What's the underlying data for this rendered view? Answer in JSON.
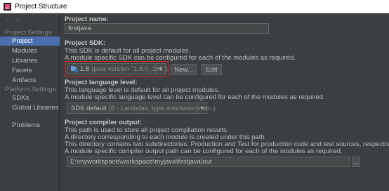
{
  "window": {
    "title": "Project Structure"
  },
  "sidebar": {
    "sections": [
      {
        "label": "Project Settings"
      },
      {
        "label": "Platform Settings"
      }
    ],
    "items": [
      {
        "label": "Project"
      },
      {
        "label": "Modules"
      },
      {
        "label": "Libraries"
      },
      {
        "label": "Facets"
      },
      {
        "label": "Artifacts"
      },
      {
        "label": "SDKs"
      },
      {
        "label": "Global Libraries"
      },
      {
        "label": "Problems"
      }
    ],
    "selected": "Project"
  },
  "project_name": {
    "label": "Project name:",
    "value": "firstjava"
  },
  "project_sdk": {
    "label": "Project SDK:",
    "desc1": "This SDK is default for all project modules.",
    "desc2": "A module specific SDK can be configured for each of the modules as required.",
    "value_main": "1.8",
    "value_detail": "(java version \"1.8.0_161\")",
    "new_label": "New...",
    "edit_label": "Edit"
  },
  "language_level": {
    "label": "Project language level:",
    "desc1": "This language level is default for all project modules.",
    "desc2": "A module specific language level can be configured for each of the modules as required.",
    "value_main": "SDK default",
    "value_detail": "(8 - Lambdas, type annotations etc.)"
  },
  "compiler_output": {
    "label": "Project compiler output:",
    "desc1": "This path is used to store all project compilation results.",
    "desc2": "A directory corresponding to each module is created under this path.",
    "desc3": "This directory contains two subdirectories: Production and Test for production code and test sources, respectively.",
    "desc4": "A module specific compiler output path can be configured for each of the modules as required.",
    "value": "E:\\myworkspace\\workspace\\myjava\\firstjava\\out",
    "browse_label": "..."
  },
  "colors": {
    "background": "#3c3f41",
    "selection": "#4b6eaf",
    "highlight_border": "#d42a2a"
  }
}
